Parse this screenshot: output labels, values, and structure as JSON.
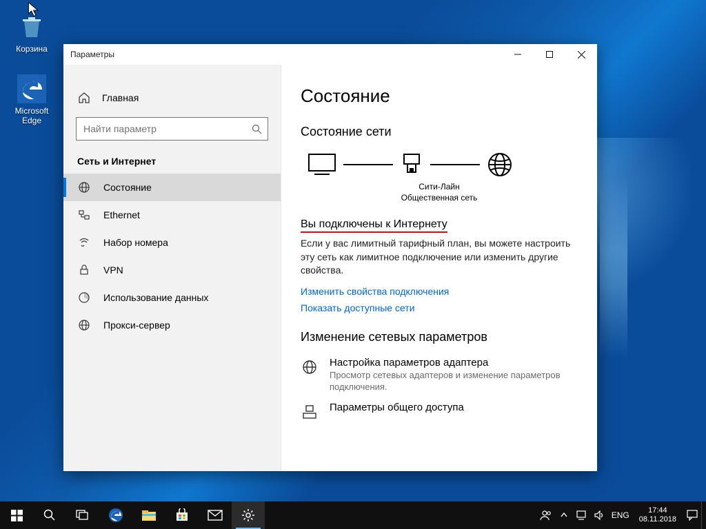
{
  "desktop_icons": {
    "recycle": "Корзина",
    "edge1": "Microsoft",
    "edge2": "Edge"
  },
  "window": {
    "title": "Параметры",
    "sidebar": {
      "home": "Главная",
      "search_placeholder": "Найти параметр",
      "section": "Сеть и Интернет",
      "items": [
        {
          "label": "Состояние"
        },
        {
          "label": "Ethernet"
        },
        {
          "label": "Набор номера"
        },
        {
          "label": "VPN"
        },
        {
          "label": "Использование данных"
        },
        {
          "label": "Прокси-сервер"
        }
      ]
    },
    "content": {
      "title": "Состояние",
      "net_status_heading": "Состояние сети",
      "diagram": {
        "conn_name": "Сити-Лайн",
        "conn_type": "Общественная сеть"
      },
      "connected_heading": "Вы подключены к Интернету",
      "connected_desc": "Если у вас лимитный тарифный план, вы можете настроить эту сеть как лимитное подключение или изменить другие свойства.",
      "link_change": "Изменить свойства подключения",
      "link_show": "Показать доступные сети",
      "change_heading": "Изменение сетевых параметров",
      "opt1_head": "Настройка параметров адаптера",
      "opt1_desc": "Просмотр сетевых адаптеров и изменение параметров подключения.",
      "opt2_head": "Параметры общего доступа"
    }
  },
  "tray": {
    "lang": "ENG",
    "time": "17:44",
    "date": "08.11.2018"
  }
}
